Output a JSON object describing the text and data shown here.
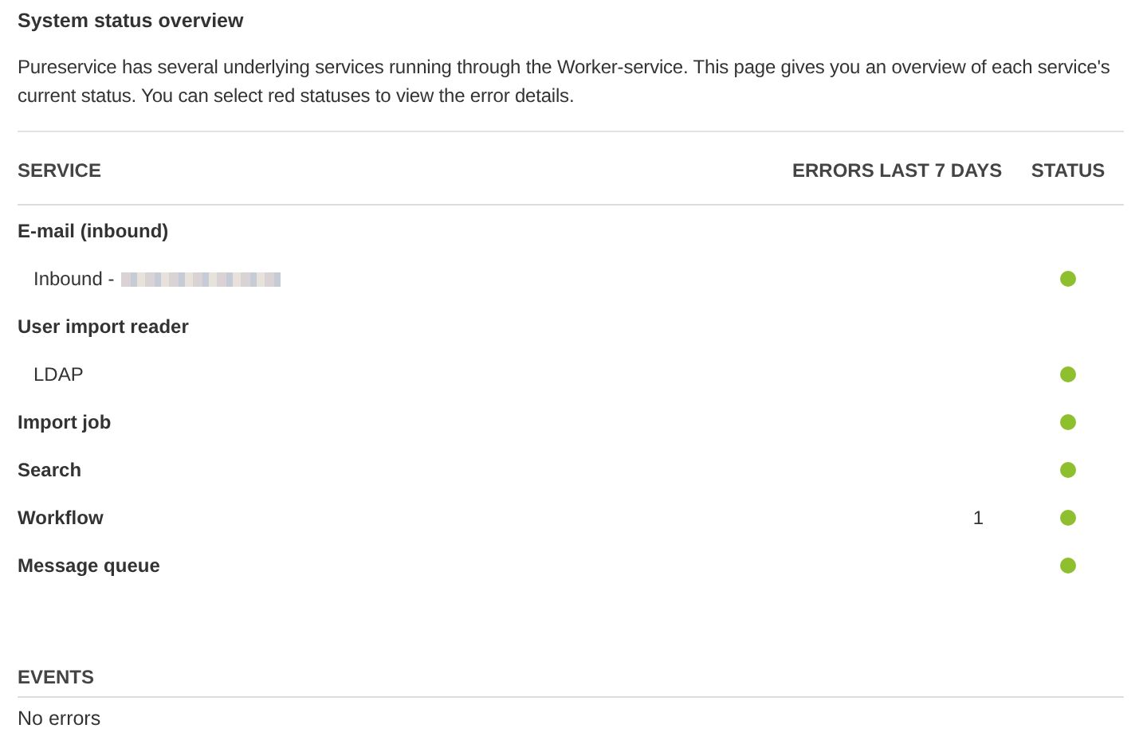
{
  "page": {
    "title": "System status overview",
    "description": "Pureservice has several underlying services running through the Worker-service. This page gives you an overview of each service's current status. You can select red statuses to view the error details."
  },
  "table": {
    "columns": [
      "SERVICE",
      "ERRORS LAST 7 DAYS",
      "STATUS"
    ],
    "rows": [
      {
        "kind": "group",
        "name": "E-mail (inbound)",
        "children": [
          {
            "kind": "item",
            "name": "Inbound -",
            "redacted": true,
            "color": "#8dbf2f"
          }
        ]
      },
      {
        "kind": "group",
        "name": "User import reader",
        "children": [
          {
            "kind": "item",
            "name": "LDAP",
            "color": "#8dbf2f"
          }
        ]
      },
      {
        "kind": "group",
        "name": "Import job",
        "color": "#8dbf2f"
      },
      {
        "kind": "group",
        "name": "Search",
        "color": "#8dbf2f"
      },
      {
        "kind": "group",
        "name": "Workflow",
        "errors": "1",
        "color": "#8dbf2f"
      },
      {
        "kind": "group",
        "name": "Message queue",
        "color": "#8dbf2f"
      }
    ]
  },
  "events": {
    "header": "EVENTS",
    "message": "No errors"
  }
}
